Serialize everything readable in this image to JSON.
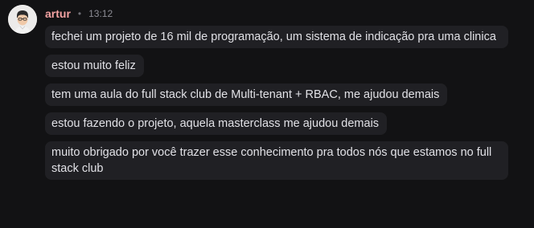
{
  "author": {
    "name": "artur",
    "separator": "•",
    "time": "13:12"
  },
  "messages": [
    {
      "text": "fechei um projeto de 16 mil de programação, um sistema de indicação pra uma clinica"
    },
    {
      "text": "estou muito feliz"
    },
    {
      "text": "tem uma aula do full stack club de Multi-tenant + RBAC, me ajudou demais"
    },
    {
      "text": "estou fazendo o projeto, aquela masterclass me ajudou demais"
    },
    {
      "text": "muito obrigado por você trazer esse conhecimento pra todos nós que estamos no full stack club"
    }
  ],
  "colors": {
    "background": "#121214",
    "bubble": "#202024",
    "author": "#f4a3a3",
    "text": "#e1e1e6"
  }
}
